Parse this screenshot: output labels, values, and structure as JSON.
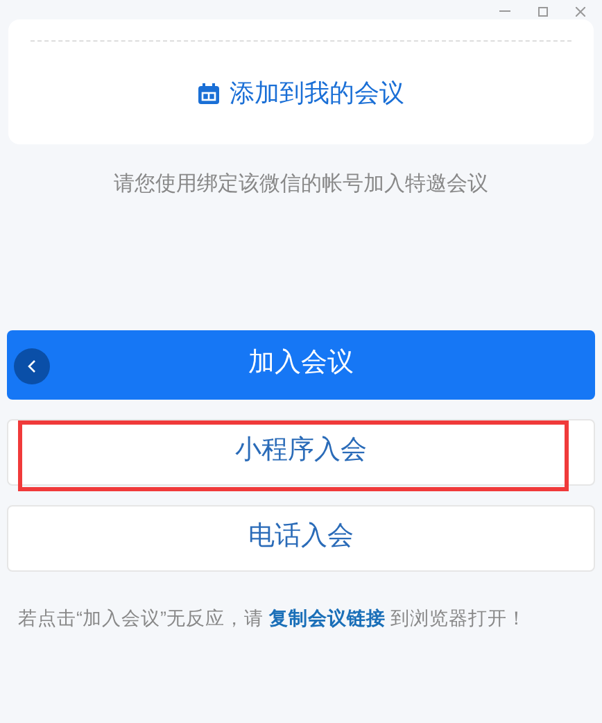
{
  "add_to_my_meetings": {
    "label": "添加到我的会议"
  },
  "hint": "请您使用绑定该微信的帐号加入特邀会议",
  "buttons": [
    {
      "kind": "primary",
      "label": "加入会议",
      "highlighted": false
    },
    {
      "kind": "secondary",
      "label": "小程序入会",
      "highlighted": true
    },
    {
      "kind": "secondary",
      "label": "电话入会",
      "highlighted": false
    }
  ],
  "footer": {
    "before": "若点击“加入会议”无反应，请",
    "link": "复制会议链接",
    "after": "到浏览器打开！"
  }
}
